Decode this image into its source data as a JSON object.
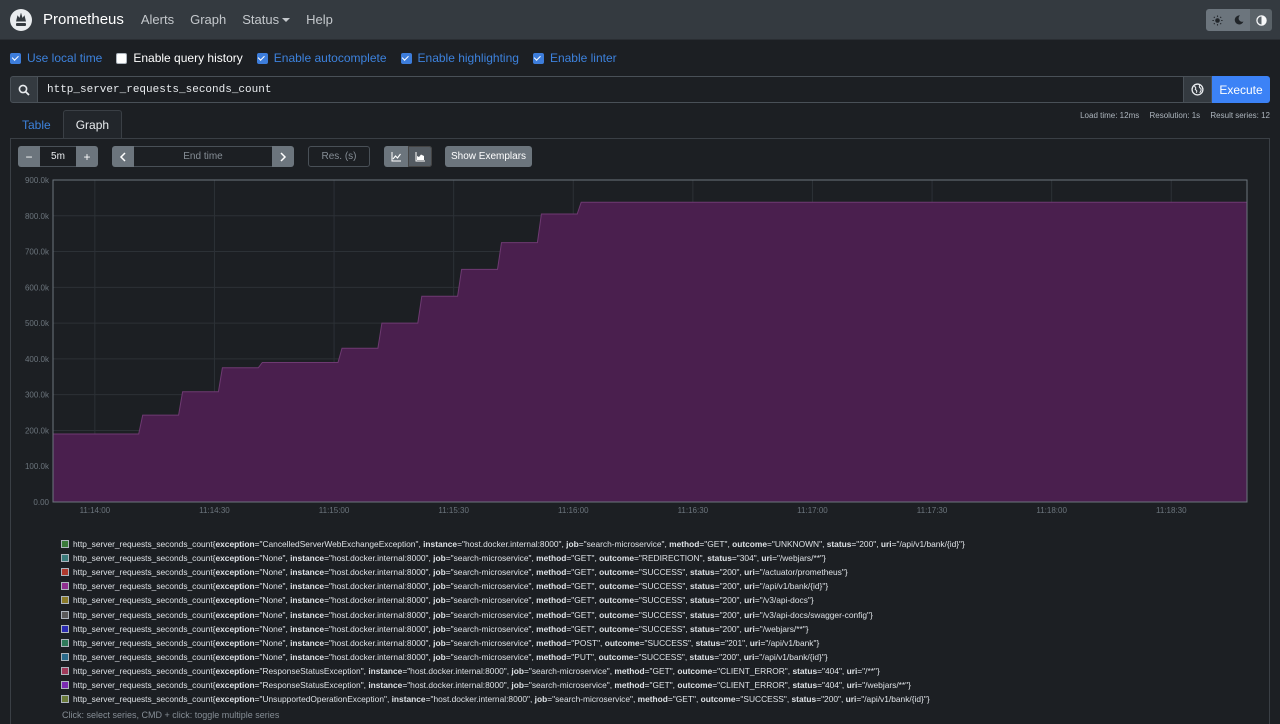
{
  "navbar": {
    "brand": "Prometheus",
    "links": [
      "Alerts",
      "Graph"
    ],
    "status_label": "Status",
    "help_label": "Help",
    "theme_icons": [
      "sun-icon",
      "moon-icon",
      "contrast-icon"
    ]
  },
  "options": [
    {
      "label": "Use local time",
      "checked": true
    },
    {
      "label": "Enable query history",
      "checked": false
    },
    {
      "label": "Enable autocomplete",
      "checked": true
    },
    {
      "label": "Enable highlighting",
      "checked": true
    },
    {
      "label": "Enable linter",
      "checked": true
    }
  ],
  "query": {
    "expression": "http_server_requests_seconds_count",
    "execute_label": "Execute"
  },
  "tabs": {
    "table": "Table",
    "graph": "Graph",
    "active": "Graph"
  },
  "stats": {
    "load_time": "Load time: 12ms",
    "resolution": "Resolution: 1s",
    "result_series": "Result series: 12"
  },
  "controls": {
    "minus": "−",
    "plus": "+",
    "range": "5m",
    "end_time_placeholder": "End time",
    "resolution_placeholder": "Res. (s)",
    "show_exemplars": "Show Exemplars",
    "chart_mode": "stacked"
  },
  "chart_data": {
    "type": "area",
    "stacked": true,
    "color": "#4a1f4e",
    "line_color": "#6e3a72",
    "x_labels": [
      "11:14:00",
      "11:14:30",
      "11:15:00",
      "11:15:30",
      "11:16:00",
      "11:16:30",
      "11:17:00",
      "11:17:30",
      "11:18:00",
      "11:18:30"
    ],
    "y_labels": [
      "0.00",
      "100.0k",
      "200.0k",
      "300.0k",
      "400.0k",
      "500.0k",
      "600.0k",
      "700.0k",
      "800.0k",
      "900.0k"
    ],
    "ylim": [
      0,
      900000
    ],
    "x_range_seconds": [
      -10.5,
      289
    ],
    "x_label_seconds": [
      0,
      30,
      60,
      90,
      120,
      150,
      180,
      210,
      240,
      270
    ],
    "total": [
      [
        -10.5,
        190000
      ],
      [
        11,
        190000
      ],
      [
        12,
        243000
      ],
      [
        21,
        243000
      ],
      [
        22,
        308000
      ],
      [
        31,
        308000
      ],
      [
        32,
        375000
      ],
      [
        41,
        375000
      ],
      [
        42,
        390000
      ],
      [
        61,
        390000
      ],
      [
        62,
        430000
      ],
      [
        71,
        430000
      ],
      [
        72,
        500000
      ],
      [
        81,
        500000
      ],
      [
        82,
        575000
      ],
      [
        91,
        575000
      ],
      [
        92,
        650000
      ],
      [
        101,
        650000
      ],
      [
        102,
        725000
      ],
      [
        111,
        725000
      ],
      [
        112,
        805000
      ],
      [
        121,
        805000
      ],
      [
        122,
        838000
      ],
      [
        289,
        838000
      ]
    ],
    "grid": true
  },
  "legend": {
    "metric": "http_server_requests_seconds_count",
    "series": [
      {
        "color": "#3a7a3a",
        "labels": [
          [
            "exception",
            "CancelledServerWebExchangeException"
          ],
          [
            "instance",
            "host.docker.internal:8000"
          ],
          [
            "job",
            "search-microservice"
          ],
          [
            "method",
            "GET"
          ],
          [
            "outcome",
            "UNKNOWN"
          ],
          [
            "status",
            "200"
          ],
          [
            "uri",
            "/api/v1/bank/{id}"
          ]
        ]
      },
      {
        "color": "#3a7a7a",
        "labels": [
          [
            "exception",
            "None"
          ],
          [
            "instance",
            "host.docker.internal:8000"
          ],
          [
            "job",
            "search-microservice"
          ],
          [
            "method",
            "GET"
          ],
          [
            "outcome",
            "REDIRECTION"
          ],
          [
            "status",
            "304"
          ],
          [
            "uri",
            "/webjars/**"
          ]
        ]
      },
      {
        "color": "#b03a2e",
        "labels": [
          [
            "exception",
            "None"
          ],
          [
            "instance",
            "host.docker.internal:8000"
          ],
          [
            "job",
            "search-microservice"
          ],
          [
            "method",
            "GET"
          ],
          [
            "outcome",
            "SUCCESS"
          ],
          [
            "status",
            "200"
          ],
          [
            "uri",
            "/actuator/prometheus"
          ]
        ]
      },
      {
        "color": "#8e2e8e",
        "labels": [
          [
            "exception",
            "None"
          ],
          [
            "instance",
            "host.docker.internal:8000"
          ],
          [
            "job",
            "search-microservice"
          ],
          [
            "method",
            "GET"
          ],
          [
            "outcome",
            "SUCCESS"
          ],
          [
            "status",
            "200"
          ],
          [
            "uri",
            "/api/v1/bank/{id}"
          ]
        ]
      },
      {
        "color": "#8a7a2a",
        "labels": [
          [
            "exception",
            "None"
          ],
          [
            "instance",
            "host.docker.internal:8000"
          ],
          [
            "job",
            "search-microservice"
          ],
          [
            "method",
            "GET"
          ],
          [
            "outcome",
            "SUCCESS"
          ],
          [
            "status",
            "200"
          ],
          [
            "uri",
            "/v3/api-docs"
          ]
        ]
      },
      {
        "color": "#5a5a5a",
        "labels": [
          [
            "exception",
            "None"
          ],
          [
            "instance",
            "host.docker.internal:8000"
          ],
          [
            "job",
            "search-microservice"
          ],
          [
            "method",
            "GET"
          ],
          [
            "outcome",
            "SUCCESS"
          ],
          [
            "status",
            "200"
          ],
          [
            "uri",
            "/v3/api-docs/swagger-config"
          ]
        ]
      },
      {
        "color": "#2a2ab0",
        "labels": [
          [
            "exception",
            "None"
          ],
          [
            "instance",
            "host.docker.internal:8000"
          ],
          [
            "job",
            "search-microservice"
          ],
          [
            "method",
            "GET"
          ],
          [
            "outcome",
            "SUCCESS"
          ],
          [
            "status",
            "200"
          ],
          [
            "uri",
            "/webjars/**"
          ]
        ]
      },
      {
        "color": "#2e7a5a",
        "labels": [
          [
            "exception",
            "None"
          ],
          [
            "instance",
            "host.docker.internal:8000"
          ],
          [
            "job",
            "search-microservice"
          ],
          [
            "method",
            "POST"
          ],
          [
            "outcome",
            "SUCCESS"
          ],
          [
            "status",
            "201"
          ],
          [
            "uri",
            "/api/v1/bank"
          ]
        ]
      },
      {
        "color": "#2a6a8a",
        "labels": [
          [
            "exception",
            "None"
          ],
          [
            "instance",
            "host.docker.internal:8000"
          ],
          [
            "job",
            "search-microservice"
          ],
          [
            "method",
            "PUT"
          ],
          [
            "outcome",
            "SUCCESS"
          ],
          [
            "status",
            "200"
          ],
          [
            "uri",
            "/api/v1/bank/{id}"
          ]
        ]
      },
      {
        "color": "#a03a5a",
        "labels": [
          [
            "exception",
            "ResponseStatusException"
          ],
          [
            "instance",
            "host.docker.internal:8000"
          ],
          [
            "job",
            "search-microservice"
          ],
          [
            "method",
            "GET"
          ],
          [
            "outcome",
            "CLIENT_ERROR"
          ],
          [
            "status",
            "404"
          ],
          [
            "uri",
            "/**"
          ]
        ]
      },
      {
        "color": "#7a2ab0",
        "labels": [
          [
            "exception",
            "ResponseStatusException"
          ],
          [
            "instance",
            "host.docker.internal:8000"
          ],
          [
            "job",
            "search-microservice"
          ],
          [
            "method",
            "GET"
          ],
          [
            "outcome",
            "CLIENT_ERROR"
          ],
          [
            "status",
            "404"
          ],
          [
            "uri",
            "/webjars/**"
          ]
        ]
      },
      {
        "color": "#6a7a3a",
        "labels": [
          [
            "exception",
            "UnsupportedOperationException"
          ],
          [
            "instance",
            "host.docker.internal:8000"
          ],
          [
            "job",
            "search-microservice"
          ],
          [
            "method",
            "GET"
          ],
          [
            "outcome",
            "SUCCESS"
          ],
          [
            "status",
            "200"
          ],
          [
            "uri",
            "/api/v1/bank/{id}"
          ]
        ]
      }
    ],
    "hint": "Click: select series, CMD + click: toggle multiple series"
  }
}
